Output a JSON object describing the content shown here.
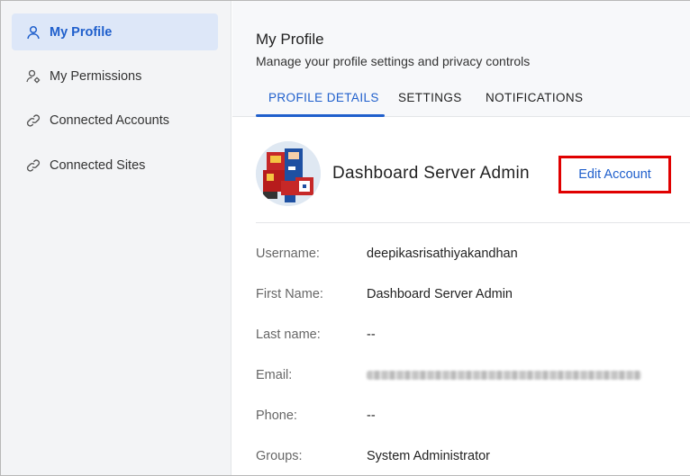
{
  "sidebar": {
    "items": [
      {
        "label": "My Profile",
        "icon": "user-icon",
        "active": true
      },
      {
        "label": "My Permissions",
        "icon": "user-gear-icon",
        "active": false
      },
      {
        "label": "Connected Accounts",
        "icon": "link-icon",
        "active": false
      },
      {
        "label": "Connected Sites",
        "icon": "link-icon",
        "active": false
      }
    ]
  },
  "header": {
    "title": "My Profile",
    "subtitle": "Manage your profile settings and privacy controls"
  },
  "tabs": [
    {
      "label": "PROFILE DETAILS",
      "active": true
    },
    {
      "label": "SETTINGS",
      "active": false
    },
    {
      "label": "NOTIFICATIONS",
      "active": false
    }
  ],
  "profile": {
    "name": "Dashboard Server Admin",
    "edit_label": "Edit Account"
  },
  "details": [
    {
      "label": "Username:",
      "value": "deepikasrisathiyakandhan"
    },
    {
      "label": "First Name:",
      "value": "Dashboard Server Admin"
    },
    {
      "label": "Last name:",
      "value": "--"
    },
    {
      "label": "Email:",
      "value": ""
    },
    {
      "label": "Phone:",
      "value": "--"
    },
    {
      "label": "Groups:",
      "value": "System Administrator"
    }
  ],
  "colors": {
    "accent": "#1f5fcc",
    "highlight_border": "#e00000",
    "sidebar_bg": "#f3f4f6",
    "active_item_bg": "#dde7f8"
  }
}
